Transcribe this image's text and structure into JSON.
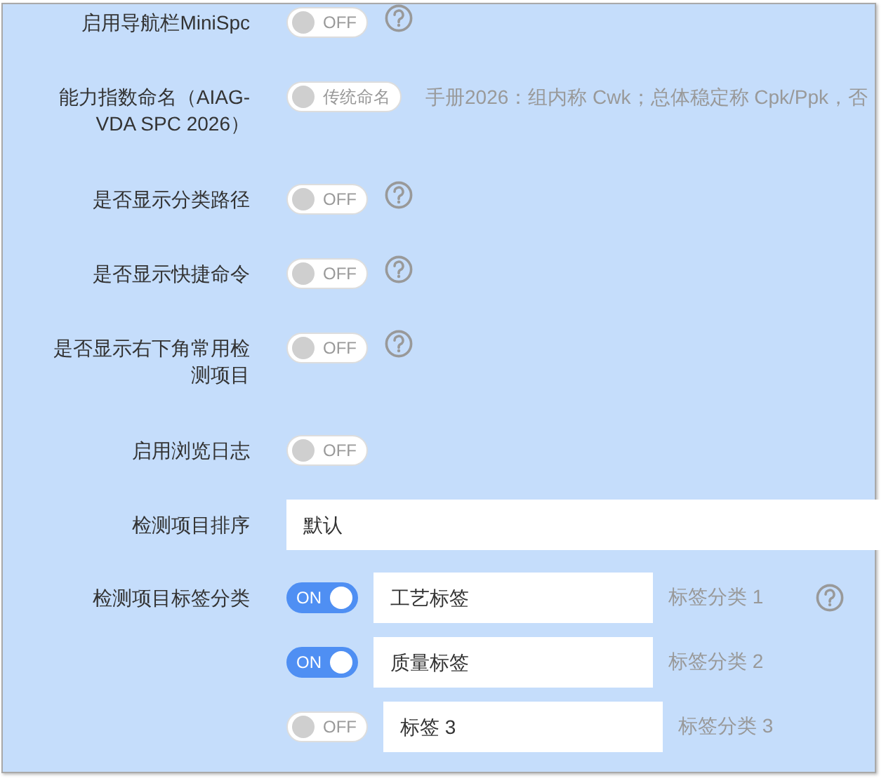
{
  "settings": [
    {
      "kind": "toggle",
      "label": "启用导航栏MiniSpc",
      "toggle": {
        "on": false,
        "text": "OFF"
      },
      "help": true
    },
    {
      "kind": "toggle",
      "label": "能力指数命名（AIAG-VDA SPC 2026）",
      "toggle": {
        "on": false,
        "text": "传统命名"
      },
      "hint": "手册2026：组内称 Cwk；总体稳定称 Cpk/Ppk，否"
    },
    {
      "kind": "toggle",
      "label": "是否显示分类路径",
      "toggle": {
        "on": false,
        "text": "OFF"
      },
      "help": true
    },
    {
      "kind": "toggle",
      "label": "是否显示快捷命令",
      "toggle": {
        "on": false,
        "text": "OFF"
      },
      "help": true
    },
    {
      "kind": "toggle",
      "label": "是否显示右下角常用检测项目",
      "toggle": {
        "on": false,
        "text": "OFF"
      },
      "help": true
    },
    {
      "kind": "toggle",
      "label": "启用浏览日志",
      "toggle": {
        "on": false,
        "text": "OFF"
      }
    },
    {
      "kind": "select",
      "label": "检测项目排序",
      "value": "默认"
    },
    {
      "kind": "tags",
      "label": "检测项目标签分类",
      "items": [
        {
          "toggle": {
            "on": true,
            "text": "ON"
          },
          "value": "工艺标签",
          "hint": "标签分类 1",
          "help": true
        },
        {
          "toggle": {
            "on": true,
            "text": "ON"
          },
          "value": "质量标签",
          "hint": "标签分类 2"
        },
        {
          "toggle": {
            "on": false,
            "text": "OFF"
          },
          "value": "标签 3",
          "hint": "标签分类 3"
        }
      ]
    }
  ]
}
